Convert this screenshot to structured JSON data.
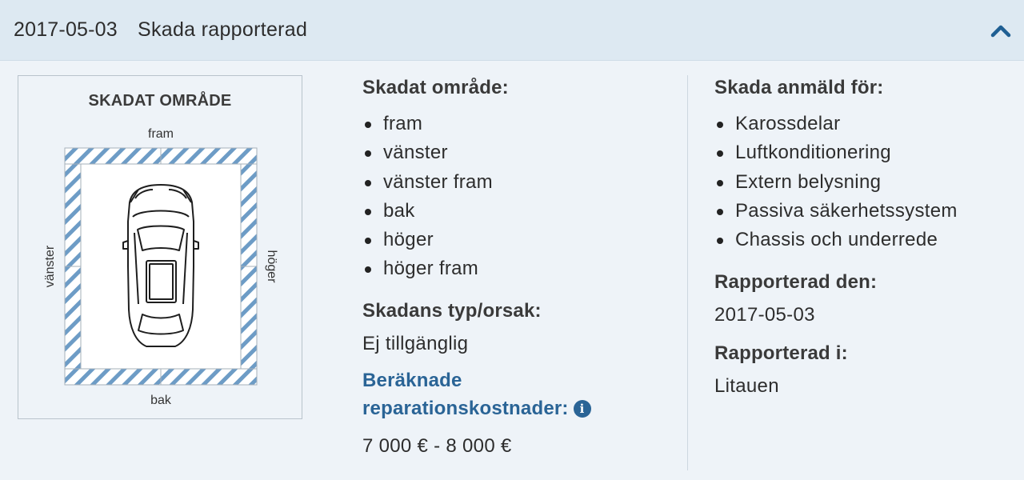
{
  "header": {
    "date": "2017-05-03",
    "title": "Skada rapporterad",
    "chevron_icon": "chevron-up-icon",
    "accent_color": "#1f5f93"
  },
  "diagram": {
    "title": "SKADAT OMRÅDE",
    "labels": {
      "front": "fram",
      "back": "bak",
      "left": "vänster",
      "right": "höger"
    },
    "damaged_zones": [
      "front-left",
      "front-right",
      "left-front",
      "left-rear",
      "rear-left",
      "rear-right",
      "right-front",
      "right-rear"
    ],
    "hatch_color": "#6d9cc6"
  },
  "damaged_area": {
    "heading": "Skadat område:",
    "items": [
      "fram",
      "vänster",
      "vänster fram",
      "bak",
      "höger",
      "höger fram"
    ]
  },
  "damage_type": {
    "heading": "Skadans typ/orsak:",
    "value": "Ej tillgänglig"
  },
  "repair_cost": {
    "heading_line1": "Beräknade",
    "heading_line2": "reparationskostnader:",
    "info_icon": "info-icon",
    "value": "7 000 € - 8 000 €"
  },
  "reported_for": {
    "heading": "Skada anmäld för:",
    "items": [
      "Karossdelar",
      "Luftkonditionering",
      "Extern belysning",
      "Passiva säkerhetssystem",
      "Chassis och underrede"
    ]
  },
  "reported_date": {
    "heading": "Rapporterad den:",
    "value": "2017-05-03"
  },
  "reported_in": {
    "heading": "Rapporterad i:",
    "value": "Litauen"
  }
}
